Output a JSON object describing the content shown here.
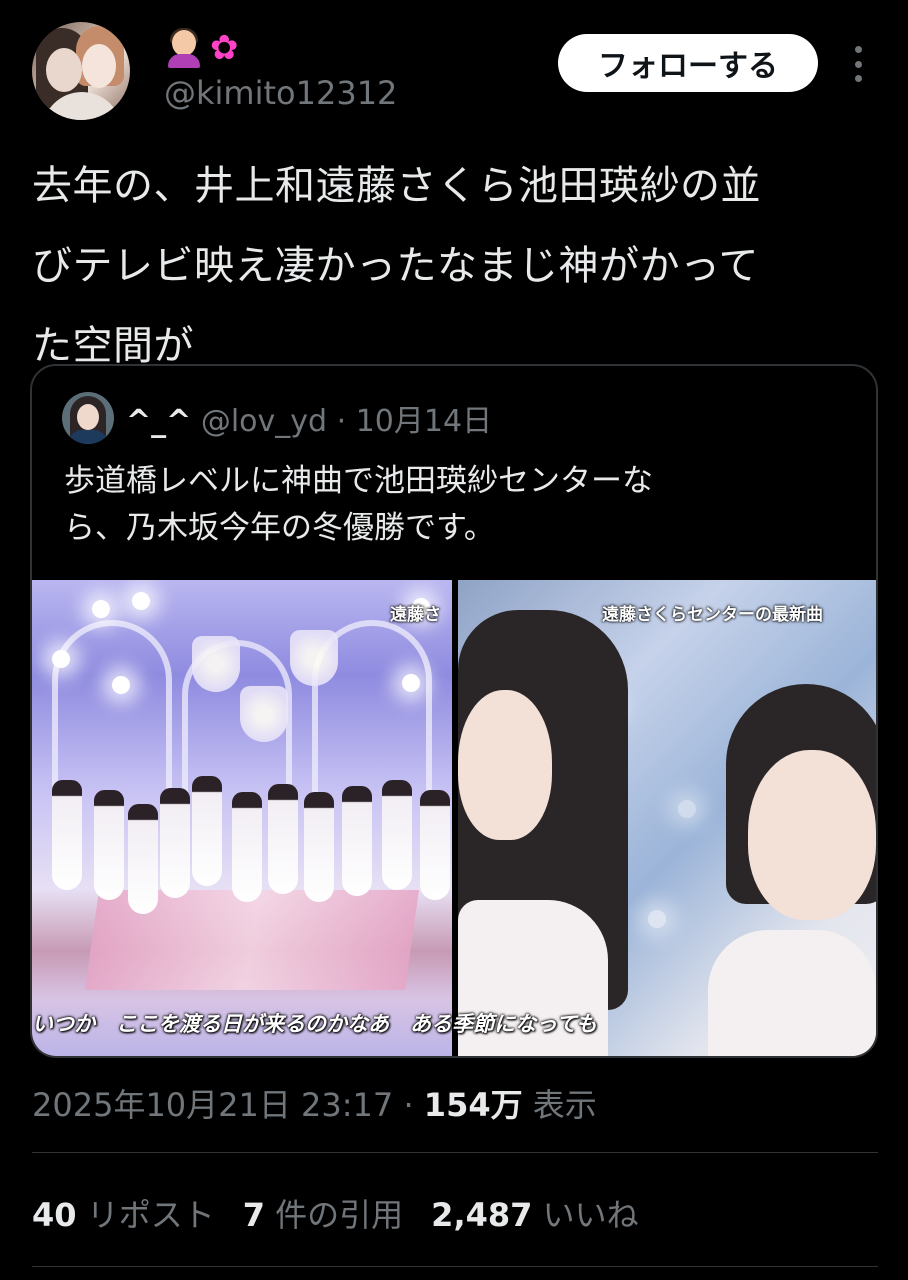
{
  "author": {
    "display_emojis": [
      "🤦‍♀️",
      "✿"
    ],
    "handle": "@kimito12312",
    "follow_label": "フォローする"
  },
  "tweet": {
    "lines": [
      "去年の、井上和遠藤さくら池田瑛紗の並",
      "びテレビ映え凄かったなまじ神がかって",
      "た空間が"
    ]
  },
  "quote": {
    "name": "^_^",
    "handle": "@lov_yd",
    "separator": "·",
    "date": "10月14日",
    "lines": [
      "歩道橋レベルに神曲で池田瑛紗センターな",
      "ら、乃木坂今年の冬優勝です。"
    ],
    "media": {
      "left_caption_top": "遠藤さ",
      "right_caption_top": "遠藤さくらセンターの最新曲",
      "bottom_caption": "いつか　ここを渡る日が来るのかなあ　ある季節になっても"
    }
  },
  "meta": {
    "timestamp": "2025年10月21日 23:17",
    "separator": "·",
    "views_count": "154万",
    "views_label": "表示"
  },
  "stats": {
    "reposts_count": "40",
    "reposts_label": "リポスト",
    "quotes_count": "7",
    "quotes_label": "件の引用",
    "likes_count": "2,487",
    "likes_label": "いいね"
  },
  "colors": {
    "background": "#000000",
    "text": "#e7e9ea",
    "muted": "#71767b",
    "border": "#2f3336",
    "flower": "#ff42c8"
  }
}
